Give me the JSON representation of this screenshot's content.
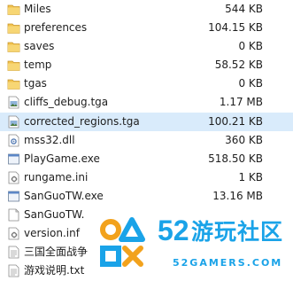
{
  "files": [
    {
      "name": "Miles",
      "size": "544 KB",
      "icon": "folder-icon"
    },
    {
      "name": "preferences",
      "size": "104.15 KB",
      "icon": "folder-icon"
    },
    {
      "name": "saves",
      "size": "0 KB",
      "icon": "folder-icon"
    },
    {
      "name": "temp",
      "size": "58.52 KB",
      "icon": "folder-icon"
    },
    {
      "name": "tgas",
      "size": "0 KB",
      "icon": "folder-icon"
    },
    {
      "name": "cliffs_debug.tga",
      "size": "1.17 MB",
      "icon": "image-file-icon"
    },
    {
      "name": "corrected_regions.tga",
      "size": "100.21 KB",
      "icon": "image-file-icon"
    },
    {
      "name": "mss32.dll",
      "size": "360 KB",
      "icon": "dll-file-icon"
    },
    {
      "name": "PlayGame.exe",
      "size": "518.50 KB",
      "icon": "exe-file-icon"
    },
    {
      "name": "rungame.ini",
      "size": "1 KB",
      "icon": "settings-file-icon"
    },
    {
      "name": "SanGuoTW.exe",
      "size": "13.16 MB",
      "icon": "exe-file-icon"
    },
    {
      "name": "SanGuoTW.",
      "size": "",
      "icon": "blank-file-icon"
    },
    {
      "name": "version.inf",
      "size": "",
      "icon": "settings-file-icon"
    },
    {
      "name": "三国全面战争",
      "size": "",
      "icon": "text-file-icon"
    },
    {
      "name": "游戏说明.txt",
      "size": "",
      "icon": "text-file-icon"
    }
  ],
  "watermark": {
    "number": "52",
    "title": "游玩社区",
    "url": "52GAMERS.COM"
  },
  "colors": {
    "folder": "#f2c24e",
    "selection": "#d9ebfb",
    "brand_blue": "#1aa3e8",
    "brand_orange": "#f2a21d"
  }
}
